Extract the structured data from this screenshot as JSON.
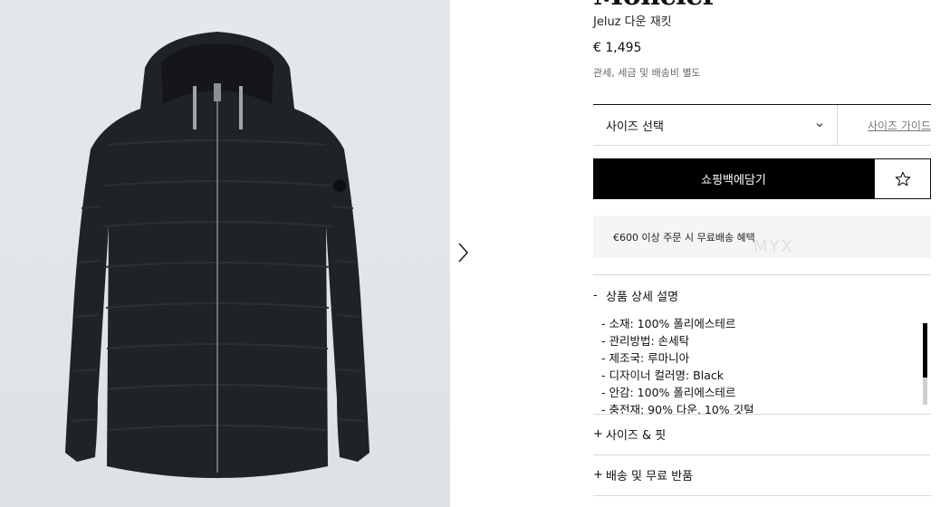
{
  "product": {
    "brand": "Moncler",
    "name": "Jeluz 다운 재킷",
    "price": "€ 1,495",
    "tax_note": "관세, 세금 및 배송비 별도"
  },
  "size": {
    "select_label": "사이즈 선택",
    "guide_label": "사이즈 가이드"
  },
  "cart": {
    "add_label": "쇼핑백에담기"
  },
  "shipping": {
    "promo": "€600 이상 주문 시 무료배송 혜택",
    "watermark": "MYX"
  },
  "accordion": {
    "details": {
      "symbol": "-",
      "title": "상품 상세 설명",
      "items": [
        "- 소재: 100% 폴리에스테르",
        "- 관리방법: 손세탁",
        "- 제조국: 루마니아",
        "- 디자이너 컬러명: Black",
        "- 안감: 100% 폴리에스테르",
        "- 충전재: 90% 다운, 10% 깃털"
      ]
    },
    "fit": {
      "symbol": "+",
      "title": "사이즈 & 핏"
    },
    "delivery": {
      "symbol": "+",
      "title": "배송 및 무료 반품"
    }
  },
  "icons": {
    "next": "chevron-right-icon",
    "dropdown": "chevron-down-icon",
    "wishlist": "star-outline-icon"
  },
  "colors": {
    "primary": "#000000",
    "image_bg": "#e2e6ea",
    "jacket": "#1f2226"
  }
}
